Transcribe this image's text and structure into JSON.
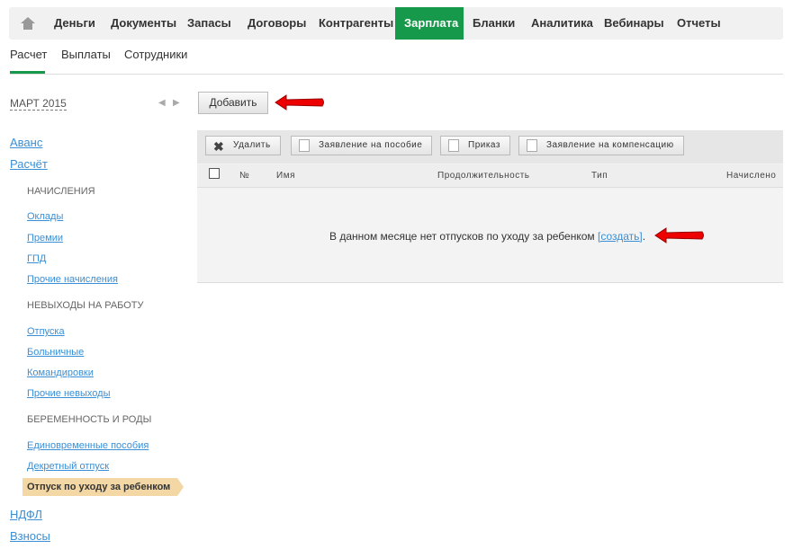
{
  "topnav": {
    "items": [
      "Деньги",
      "Документы",
      "Запасы",
      "Договоры",
      "Контрагенты",
      "Зарплата",
      "Бланки",
      "Аналитика",
      "Вебинары",
      "Отчеты"
    ],
    "active": "Зарплата"
  },
  "subnav": {
    "items": [
      "Расчет",
      "Выплаты",
      "Сотрудники"
    ],
    "active": "Расчет"
  },
  "sidebar": {
    "period": "МАРТ 2015",
    "top_links": [
      "Аванс",
      "Расчёт"
    ],
    "sections": [
      {
        "title": "НАЧИСЛЕНИЯ",
        "items": [
          "Оклады",
          "Премии",
          "ГПД",
          "Прочие начисления"
        ]
      },
      {
        "title": "НЕВЫХОДЫ НА РАБОТУ",
        "items": [
          "Отпуска",
          "Больничные",
          "Командировки",
          "Прочие невыходы"
        ]
      },
      {
        "title": "БЕРЕМЕННОСТЬ И РОДЫ",
        "items": [
          "Единовременные пособия",
          "Декретный отпуск"
        ]
      }
    ],
    "active": "Отпуск по уходу за ребенком",
    "bottom_links": [
      "НДФЛ",
      "Взносы"
    ]
  },
  "main": {
    "add_label": "Добавить",
    "toolbar": [
      "Удалить",
      "Заявление на пособие",
      "Приказ",
      "Заявление на компенсацию"
    ],
    "columns": [
      "№",
      "Имя",
      "Продолжительность",
      "Тип",
      "Начислено"
    ],
    "empty_text": "В данном месяце нет отпусков по уходу за ребенком",
    "create_link": "[создать]",
    "period_end": "."
  }
}
